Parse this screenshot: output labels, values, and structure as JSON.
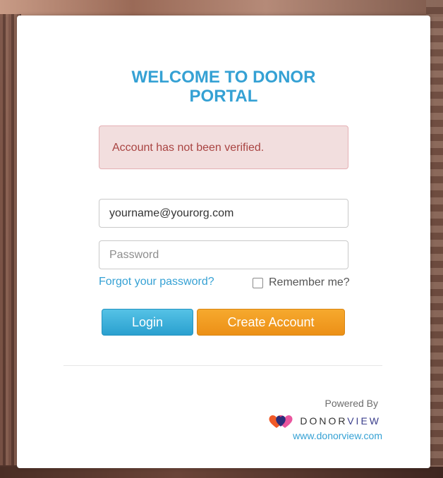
{
  "portal": {
    "title": "WELCOME TO DONOR PORTAL"
  },
  "alert": {
    "message": "Account has not been verified."
  },
  "form": {
    "email_value": "yourname@yourorg.com",
    "password_placeholder": "Password",
    "forgot_label": "Forgot your password?",
    "remember_label": "Remember me?",
    "remember_checked": false
  },
  "buttons": {
    "login_label": "Login",
    "create_label": "Create Account"
  },
  "footer": {
    "powered_by": "Powered By",
    "brand_part1": "DONOR",
    "brand_part2": "VIEW",
    "website": "www.donorview.com"
  },
  "colors": {
    "accent_blue": "#35a1d4",
    "login_button": "#2aa0cf",
    "create_button": "#ec9017",
    "alert_bg": "#f2dede",
    "alert_text": "#a94442"
  },
  "icons": {
    "brand_logo": "donorview-heart-logo-icon"
  }
}
